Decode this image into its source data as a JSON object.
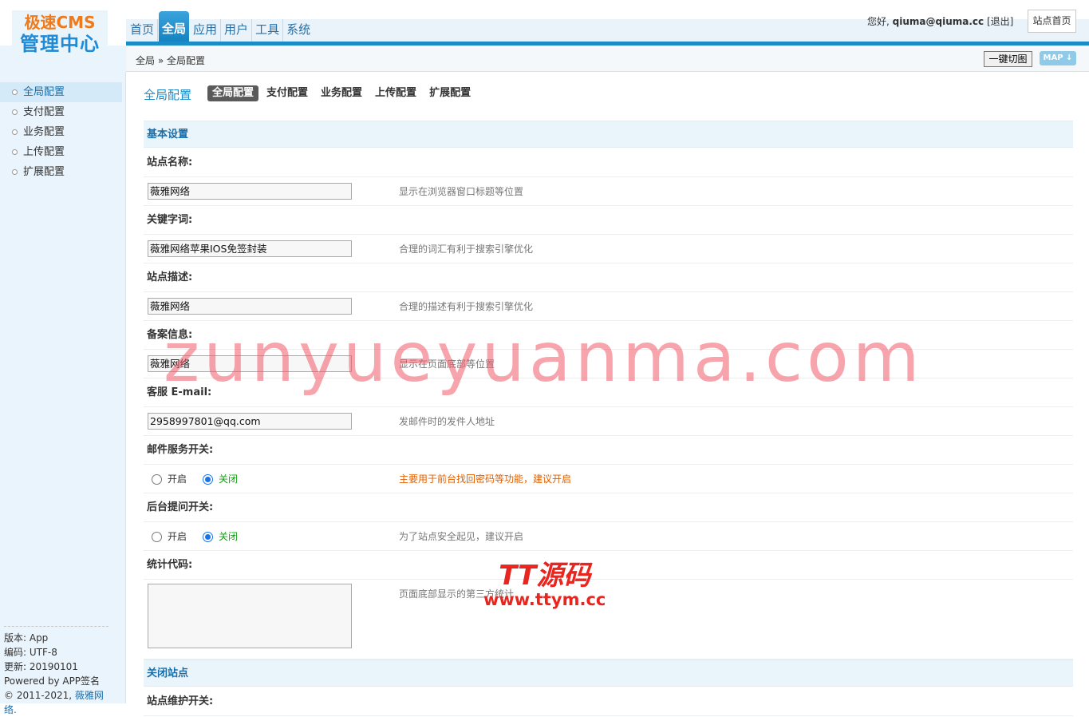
{
  "logo": {
    "line1": "极速CMS",
    "line2": "管理中心"
  },
  "nav": [
    "首页",
    "全局",
    "应用",
    "用户",
    "工具",
    "系统"
  ],
  "nav_active": 1,
  "user": {
    "greeting": "您好,",
    "name": "qiuma@qiuma.cc",
    "logout": "[退出]"
  },
  "site_home": "站点首页",
  "breadcrumb": "全局 » 全局配置",
  "toolbar": {
    "cut_label": "一键切图",
    "map_label": "MAP ↓"
  },
  "sidebar": {
    "items": [
      "全局配置",
      "支付配置",
      "业务配置",
      "上传配置",
      "扩展配置"
    ],
    "active": 0,
    "info": {
      "version": "版本: App",
      "encoding": "编码: UTF-8",
      "updated": "更新: 20190101",
      "powered": "Powered by APP签名",
      "copyright_prefix": "© 2011-2021, ",
      "copyright_brand": "薇雅网络."
    }
  },
  "content": {
    "title": "全局配置",
    "tabs": [
      "全局配置",
      "支付配置",
      "业务配置",
      "上传配置",
      "扩展配置"
    ],
    "tab_active": 0,
    "section_basic": "基本设置",
    "fields": {
      "site_name": {
        "label": "站点名称:",
        "value": "薇雅网络",
        "hint": "显示在浏览器窗口标题等位置"
      },
      "keywords": {
        "label": "关键字词:",
        "value": "薇雅网络苹果IOS免签封装",
        "hint": "合理的词汇有利于搜索引擎优化"
      },
      "description": {
        "label": "站点描述:",
        "value": "薇雅网络",
        "hint": "合理的描述有利于搜索引擎优化"
      },
      "icp": {
        "label": "备案信息:",
        "value": "薇雅网络",
        "hint": "显示在页面底部等位置"
      },
      "email": {
        "label": "客服 E-mail:",
        "value": "2958997801@qq.com",
        "hint": "发邮件时的发件人地址"
      },
      "mail_switch": {
        "label": "邮件服务开关:",
        "on": "开启",
        "off": "关闭",
        "hint": "主要用于前台找回密码等功能，建议开启"
      },
      "admin_question": {
        "label": "后台提问开关:",
        "on": "开启",
        "off": "关闭",
        "hint": "为了站点安全起见，建议开启"
      },
      "stats_code": {
        "label": "统计代码:",
        "value": "",
        "hint": "页面底部显示的第三方统计"
      }
    },
    "section_close": "关闭站点",
    "maintenance_label": "站点维护开关:"
  },
  "watermark": {
    "text": "zunyueyuanma.com",
    "logo_line1": "TT源码",
    "logo_line2": "www.ttym.cc"
  },
  "colors": {
    "accent": "#1a8cc7",
    "warn": "#e06000",
    "on": "#12a012",
    "watermark": "#f05a69"
  }
}
